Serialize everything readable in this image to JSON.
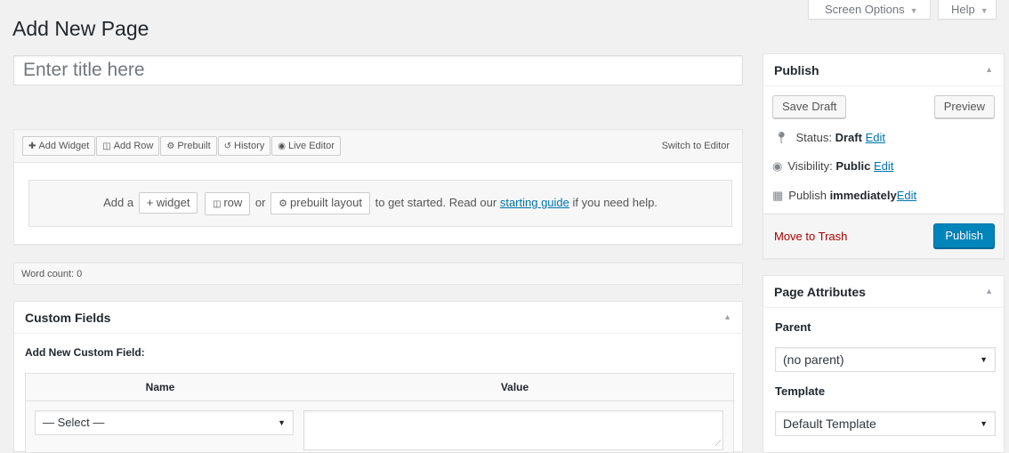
{
  "screen_options": {
    "screen_options_label": "Screen Options",
    "help_label": "Help",
    "arrow": "▼"
  },
  "page_title": "Add New Page",
  "title_field": {
    "placeholder": "Enter title here",
    "value": ""
  },
  "page_builder": {
    "toolbar": {
      "add_widget": "Add Widget",
      "add_row": "Add Row",
      "prebuilt": "Prebuilt",
      "history": "History",
      "live_editor": "Live Editor",
      "switch_to_editor": "Switch to Editor"
    },
    "empty_state": {
      "prefix": "Add a",
      "widget_chip": "widget",
      "or_1": "",
      "row_chip": "row",
      "or_2": "or",
      "prebuilt_chip": "prebuilt layout",
      "middle": "to get started. Read our",
      "link_text": "starting guide",
      "suffix": "if you need help."
    }
  },
  "word_count": "Word count: 0",
  "custom_fields": {
    "heading": "Custom Fields",
    "add_new_label": "Add New Custom Field:",
    "columns": [
      "Name",
      "Value"
    ],
    "name_select_value": "— Select —",
    "value_text": ""
  },
  "publish_box": {
    "heading": "Publish",
    "save_draft": "Save Draft",
    "preview": "Preview",
    "status_label": "Status:",
    "status_value": "Draft",
    "visibility_label": "Visibility:",
    "visibility_value": "Public",
    "publish_label": "Publish",
    "publish_value": "immediately",
    "edit_link": "Edit",
    "move_to_trash": "Move to Trash",
    "publish_button": "Publish"
  },
  "page_attributes": {
    "heading": "Page Attributes",
    "parent_label": "Parent",
    "parent_value": "(no parent)",
    "template_label": "Template",
    "template_value": "Default Template"
  },
  "colors": {
    "primary": "#0085ba",
    "link": "#0073aa",
    "trash": "#aa0000"
  }
}
